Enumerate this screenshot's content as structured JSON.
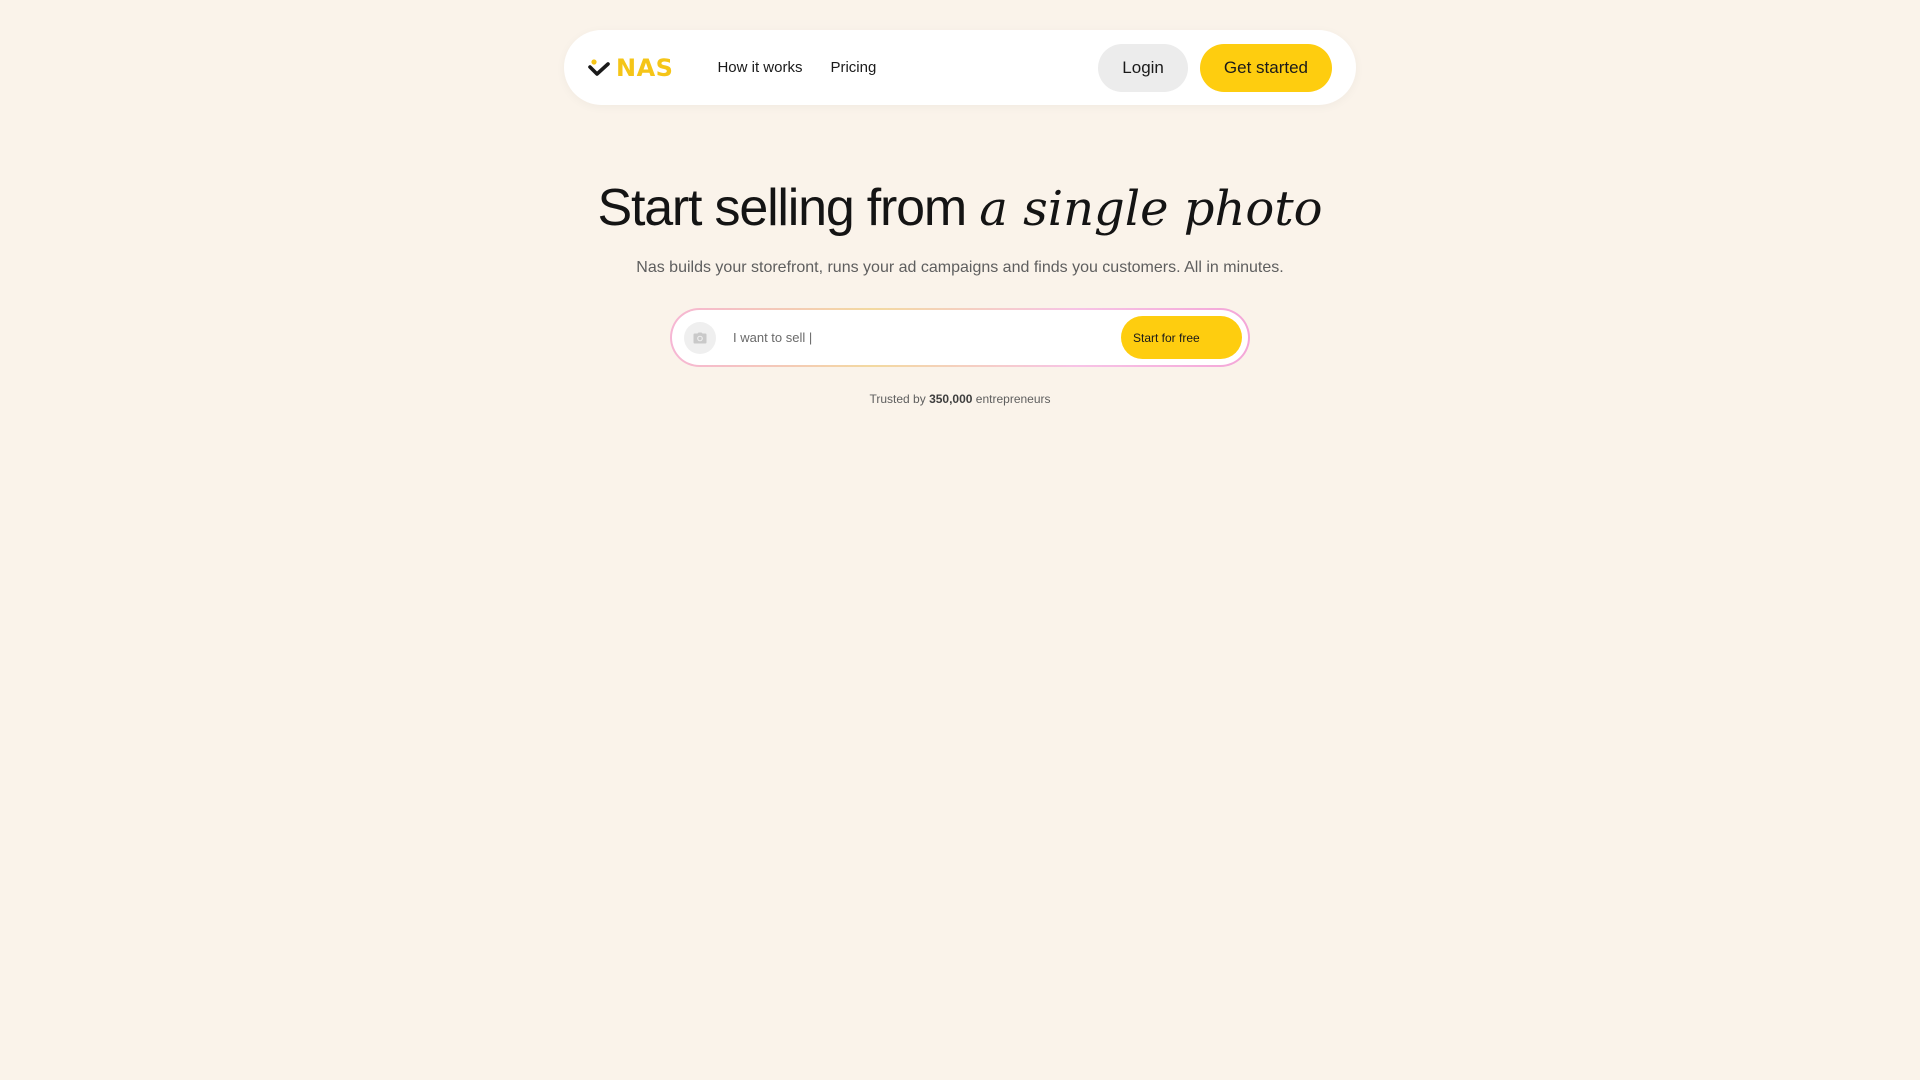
{
  "brand": {
    "name": "NAS",
    "accent_color": "#fecd0f",
    "logo_color": "#f5c518"
  },
  "nav": {
    "links": [
      {
        "label": "How it works"
      },
      {
        "label": "Pricing"
      }
    ],
    "login_label": "Login",
    "get_started_label": "Get started"
  },
  "hero": {
    "title_plain": "Start selling from",
    "title_italic": "a single photo",
    "subtitle": "Nas builds your storefront, runs your ad campaigns and finds you customers. All in minutes."
  },
  "search": {
    "camera_icon": "camera-icon",
    "placeholder": "I want to sell |",
    "value": "",
    "button_label": "Start for free"
  },
  "trusted": {
    "prefix": "Trusted by",
    "count": "350,000",
    "suffix": "entrepreneurs"
  }
}
